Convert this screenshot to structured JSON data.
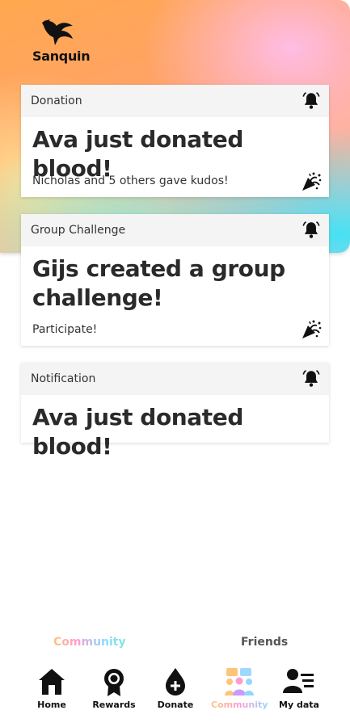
{
  "app": {
    "logo_text": "Sanquin"
  },
  "feed": [
    {
      "category": "Donation",
      "title": "Ava just donated blood!",
      "subtitle": "Nicholas and 5 others gave kudos!"
    },
    {
      "category": "Group Challenge",
      "title": "Gijs created a group challenge!",
      "subtitle": "Participate!"
    },
    {
      "category": "Notification",
      "title": "Ava just donated blood!"
    }
  ],
  "tabs": {
    "community": "Community",
    "friends": "Friends"
  },
  "nav": [
    {
      "label": "Home",
      "icon": "home-icon"
    },
    {
      "label": "Rewards",
      "icon": "rewards-icon"
    },
    {
      "label": "Donate",
      "icon": "donate-icon"
    },
    {
      "label": "Community",
      "icon": "community-icon",
      "active": true
    },
    {
      "label": "My data",
      "icon": "my-data-icon"
    }
  ],
  "colors": {
    "accent_orange": "#ffa84f",
    "accent_pink": "#ff9bd2",
    "accent_cyan": "#46e1f5"
  }
}
